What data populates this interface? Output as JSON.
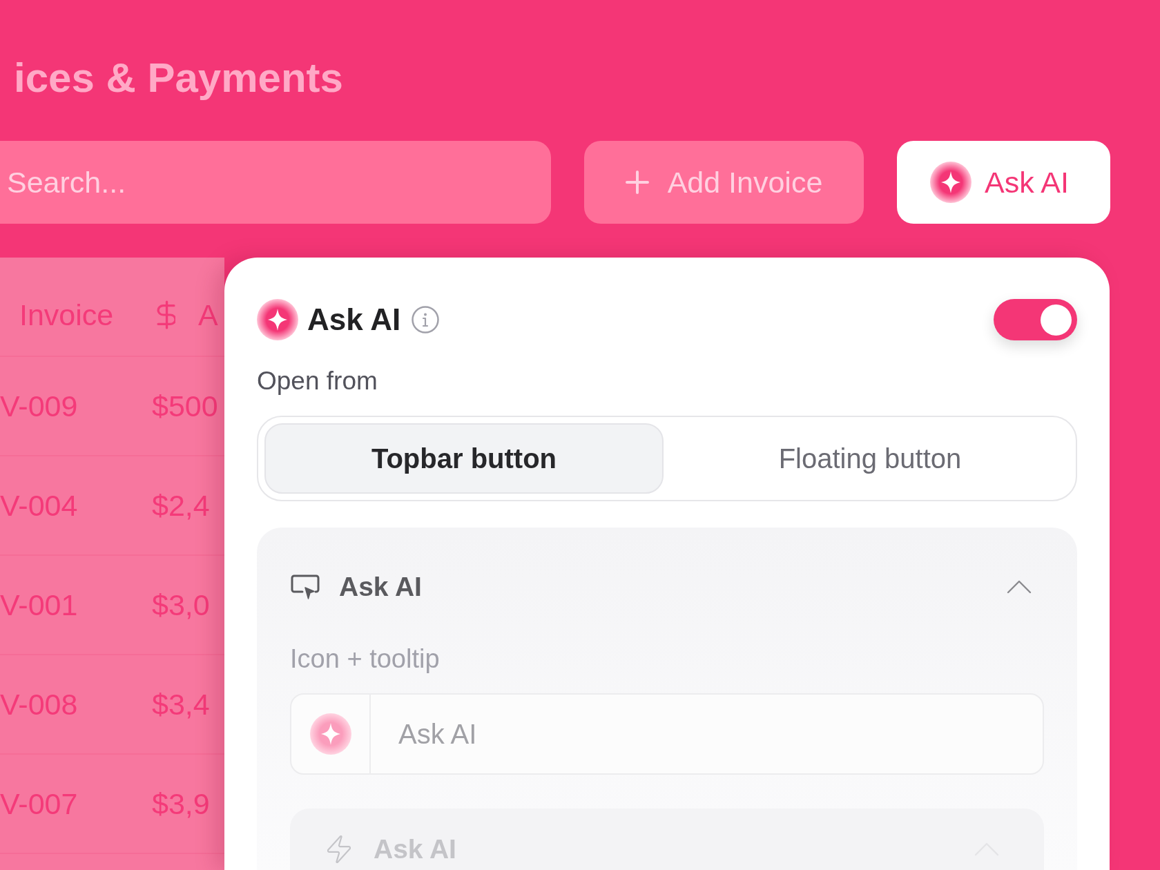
{
  "page": {
    "title": "ices & Payments"
  },
  "toolbar": {
    "search": {
      "placeholder": "Search..."
    },
    "buttons": [
      {
        "kind": "add",
        "label": "Add Invoice"
      },
      {
        "kind": "ai",
        "label": "Ask AI"
      }
    ]
  },
  "table": {
    "columns": [
      {
        "kind": "text",
        "label": "Invoice"
      },
      {
        "kind": "amount",
        "label": "A"
      }
    ],
    "rows": [
      [
        "V-009",
        "$500"
      ],
      [
        "V-004",
        "$2,4"
      ],
      [
        "V-001",
        "$3,0"
      ],
      [
        "V-008",
        "$3,4"
      ],
      [
        "V-007",
        "$3,9"
      ]
    ]
  },
  "panel": {
    "title": "Ask AI",
    "on": true,
    "open_from": {
      "label": "Open from",
      "options": [
        {
          "label": "Topbar button",
          "selected": true
        },
        {
          "label": "Floating button",
          "selected": false
        }
      ]
    },
    "sections": [
      {
        "kind": "topbar",
        "title": "Ask AI",
        "expanded": true,
        "style_label": "Icon + tooltip",
        "preview": {
          "placeholder": "Ask AI"
        },
        "subsection": {
          "kind": "floating",
          "title": "Ask AI",
          "expanded": true
        }
      }
    ]
  }
}
